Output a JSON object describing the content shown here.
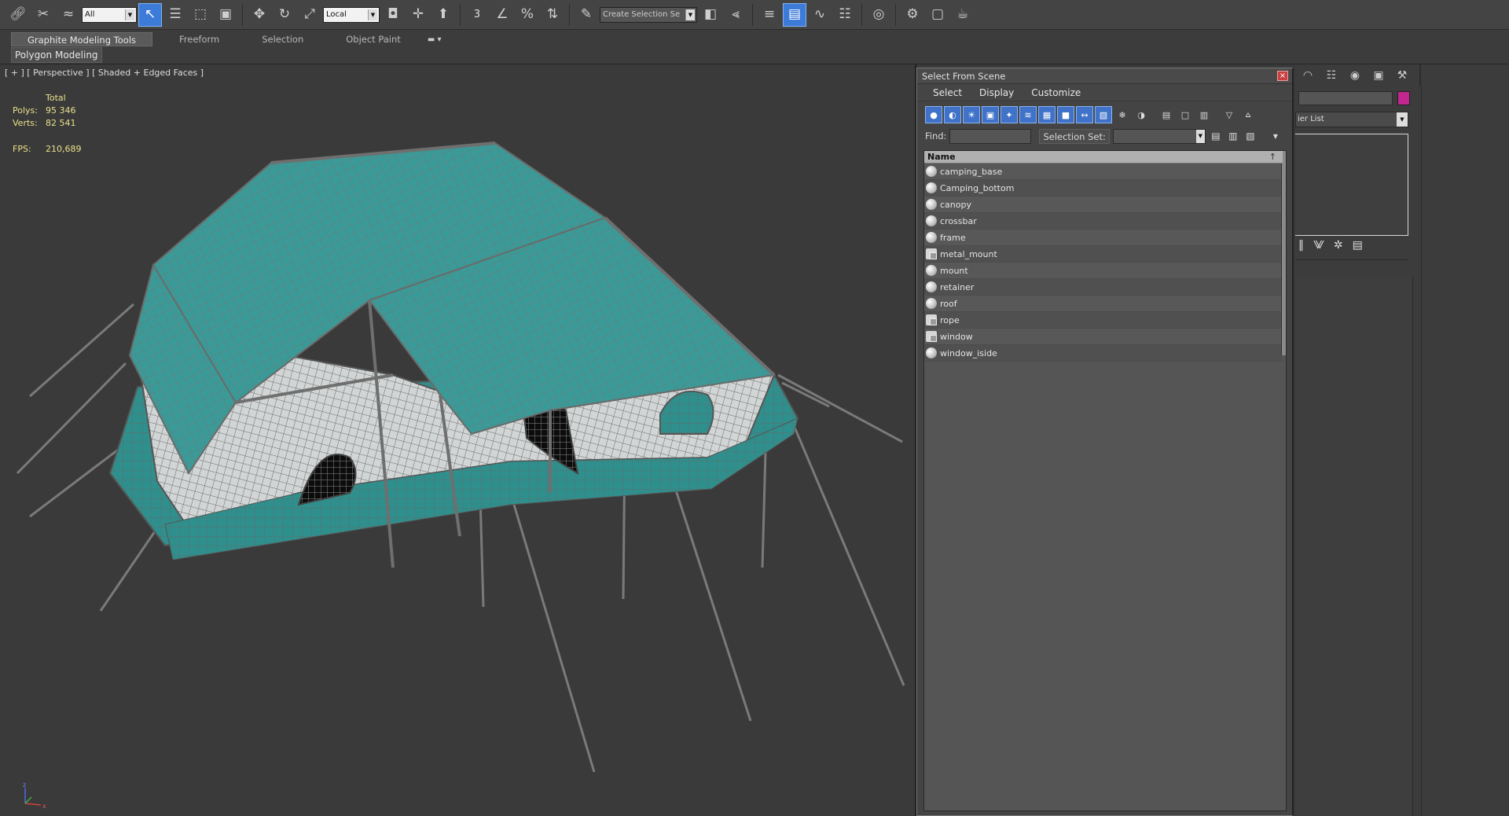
{
  "toolbar": {
    "filter_value": "All",
    "coord_system_value": "Local",
    "snap_number": "3",
    "create_selection_set_placeholder": "Create Selection Se"
  },
  "ribbon": {
    "tabs": [
      "Graphite Modeling Tools",
      "Freeform",
      "Selection",
      "Object Paint"
    ],
    "extra": "▬ ▾",
    "sub_tab": "Polygon Modeling"
  },
  "viewport": {
    "label": "[ + ] [ Perspective ] [ Shaded + Edged Faces ]",
    "stats": {
      "total_label": "Total",
      "polys_label": "Polys:",
      "polys_value": "95 346",
      "verts_label": "Verts:",
      "verts_value": "82 541",
      "fps_label": "FPS:",
      "fps_value": "210,689"
    },
    "axis_labels": {
      "z": "z",
      "x": "x"
    }
  },
  "dialog": {
    "title": "Select From Scene",
    "close": "×",
    "menu": [
      "Select",
      "Display",
      "Customize"
    ],
    "find_label": "Find:",
    "selection_set_label": "Selection Set:",
    "list_header": "Name",
    "sort_mark": "↑",
    "objects": [
      {
        "name": "camping_base",
        "type": "geometry"
      },
      {
        "name": "Camping_bottom",
        "type": "geometry"
      },
      {
        "name": "canopy",
        "type": "geometry"
      },
      {
        "name": "crossbar",
        "type": "geometry"
      },
      {
        "name": "frame",
        "type": "geometry"
      },
      {
        "name": "metal_mount",
        "type": "group"
      },
      {
        "name": "mount",
        "type": "geometry"
      },
      {
        "name": "retainer",
        "type": "geometry"
      },
      {
        "name": "roof",
        "type": "geometry"
      },
      {
        "name": "rope",
        "type": "group"
      },
      {
        "name": "window",
        "type": "group"
      },
      {
        "name": "window_iside",
        "type": "geometry"
      }
    ]
  },
  "command_panel": {
    "modifier_list_label": "ier List",
    "object_color": "#c0278f"
  },
  "colors": {
    "tent_teal": "#2e8f8c",
    "tent_wall": "#cfd2d2",
    "wireframe": "#707070",
    "selection_blue": "#3d7bd8",
    "stats_yellow": "#e9e08a"
  }
}
